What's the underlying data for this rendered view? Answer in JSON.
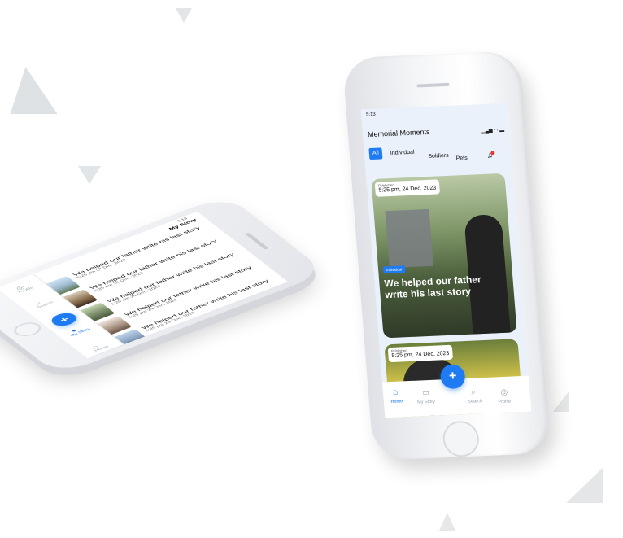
{
  "colors": {
    "accent": "#1e7bf2",
    "screen_bg": "#eaf1fb",
    "text": "#111111"
  },
  "right_phone": {
    "status_time": "5:13",
    "app_title": "Memorial Moments",
    "filters": [
      "All",
      "Individual",
      "Soldiers",
      "Pets"
    ],
    "bell_icon": "bell-icon",
    "cards": [
      {
        "status": "Published",
        "date": "5:25 pm, 24 Dec, 2023",
        "category": "Individual",
        "title": "We helped our father write his last story"
      },
      {
        "status": "Published",
        "date": "5:25 pm, 24 Dec, 2023"
      }
    ],
    "nav": {
      "home": "Home",
      "my_story": "My Story",
      "search": "Search",
      "profile": "Profile",
      "fab": "+"
    }
  },
  "left_phone": {
    "status_time": "5:13",
    "title": "My Story",
    "rows": [
      {
        "title": "We helped our father write his last story",
        "time": "5:25 pm",
        "date": "24 Dec, 2023"
      },
      {
        "title": "We helped our father write his last story",
        "time": "5:25 pm",
        "date": "24 Dec, 2023"
      },
      {
        "title": "We helped our father write his last story",
        "time": "5:25 pm",
        "date": "24 Dec, 2023"
      },
      {
        "title": "We helped our father write his last story",
        "time": "5:25 pm",
        "date": "24 Dec, 2023"
      },
      {
        "title": "We helped our father write his last story",
        "time": "5:25 pm",
        "date": "24 Dec, 2023"
      }
    ],
    "nav": {
      "home": "Home",
      "my_story": "My Story",
      "search": "Search",
      "profile": "Profile",
      "fab": "+"
    }
  }
}
